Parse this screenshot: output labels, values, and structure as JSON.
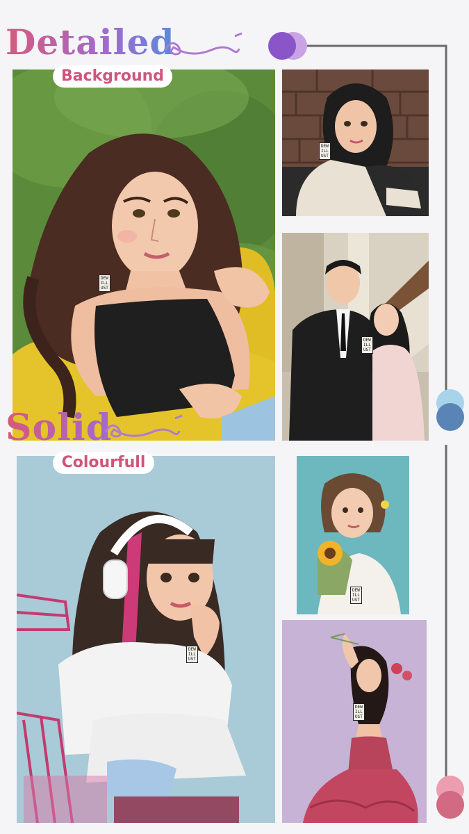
{
  "sections": [
    {
      "title": "Detailed",
      "subtitle": "Background"
    },
    {
      "title": "Solid",
      "subtitle": "Colourfull"
    }
  ],
  "colors": {
    "title_gradient_1": [
      "#d65a7a",
      "#a06ad0",
      "#5a8ad8"
    ],
    "title_gradient_2": [
      "#d65a7a",
      "#a06ad0"
    ],
    "subtitle": "#d0557a",
    "dot_purple": "#8a55c8",
    "dot_lilac": "#c9a3e6",
    "dot_sky": "#a7d4ea",
    "dot_steel": "#5b84b6",
    "dot_pink": "#ec9db0",
    "dot_rose": "#d16a82",
    "line": "#6a6a6a"
  },
  "stamp": {
    "lines": [
      "DEW",
      "ILL",
      "UST"
    ]
  }
}
